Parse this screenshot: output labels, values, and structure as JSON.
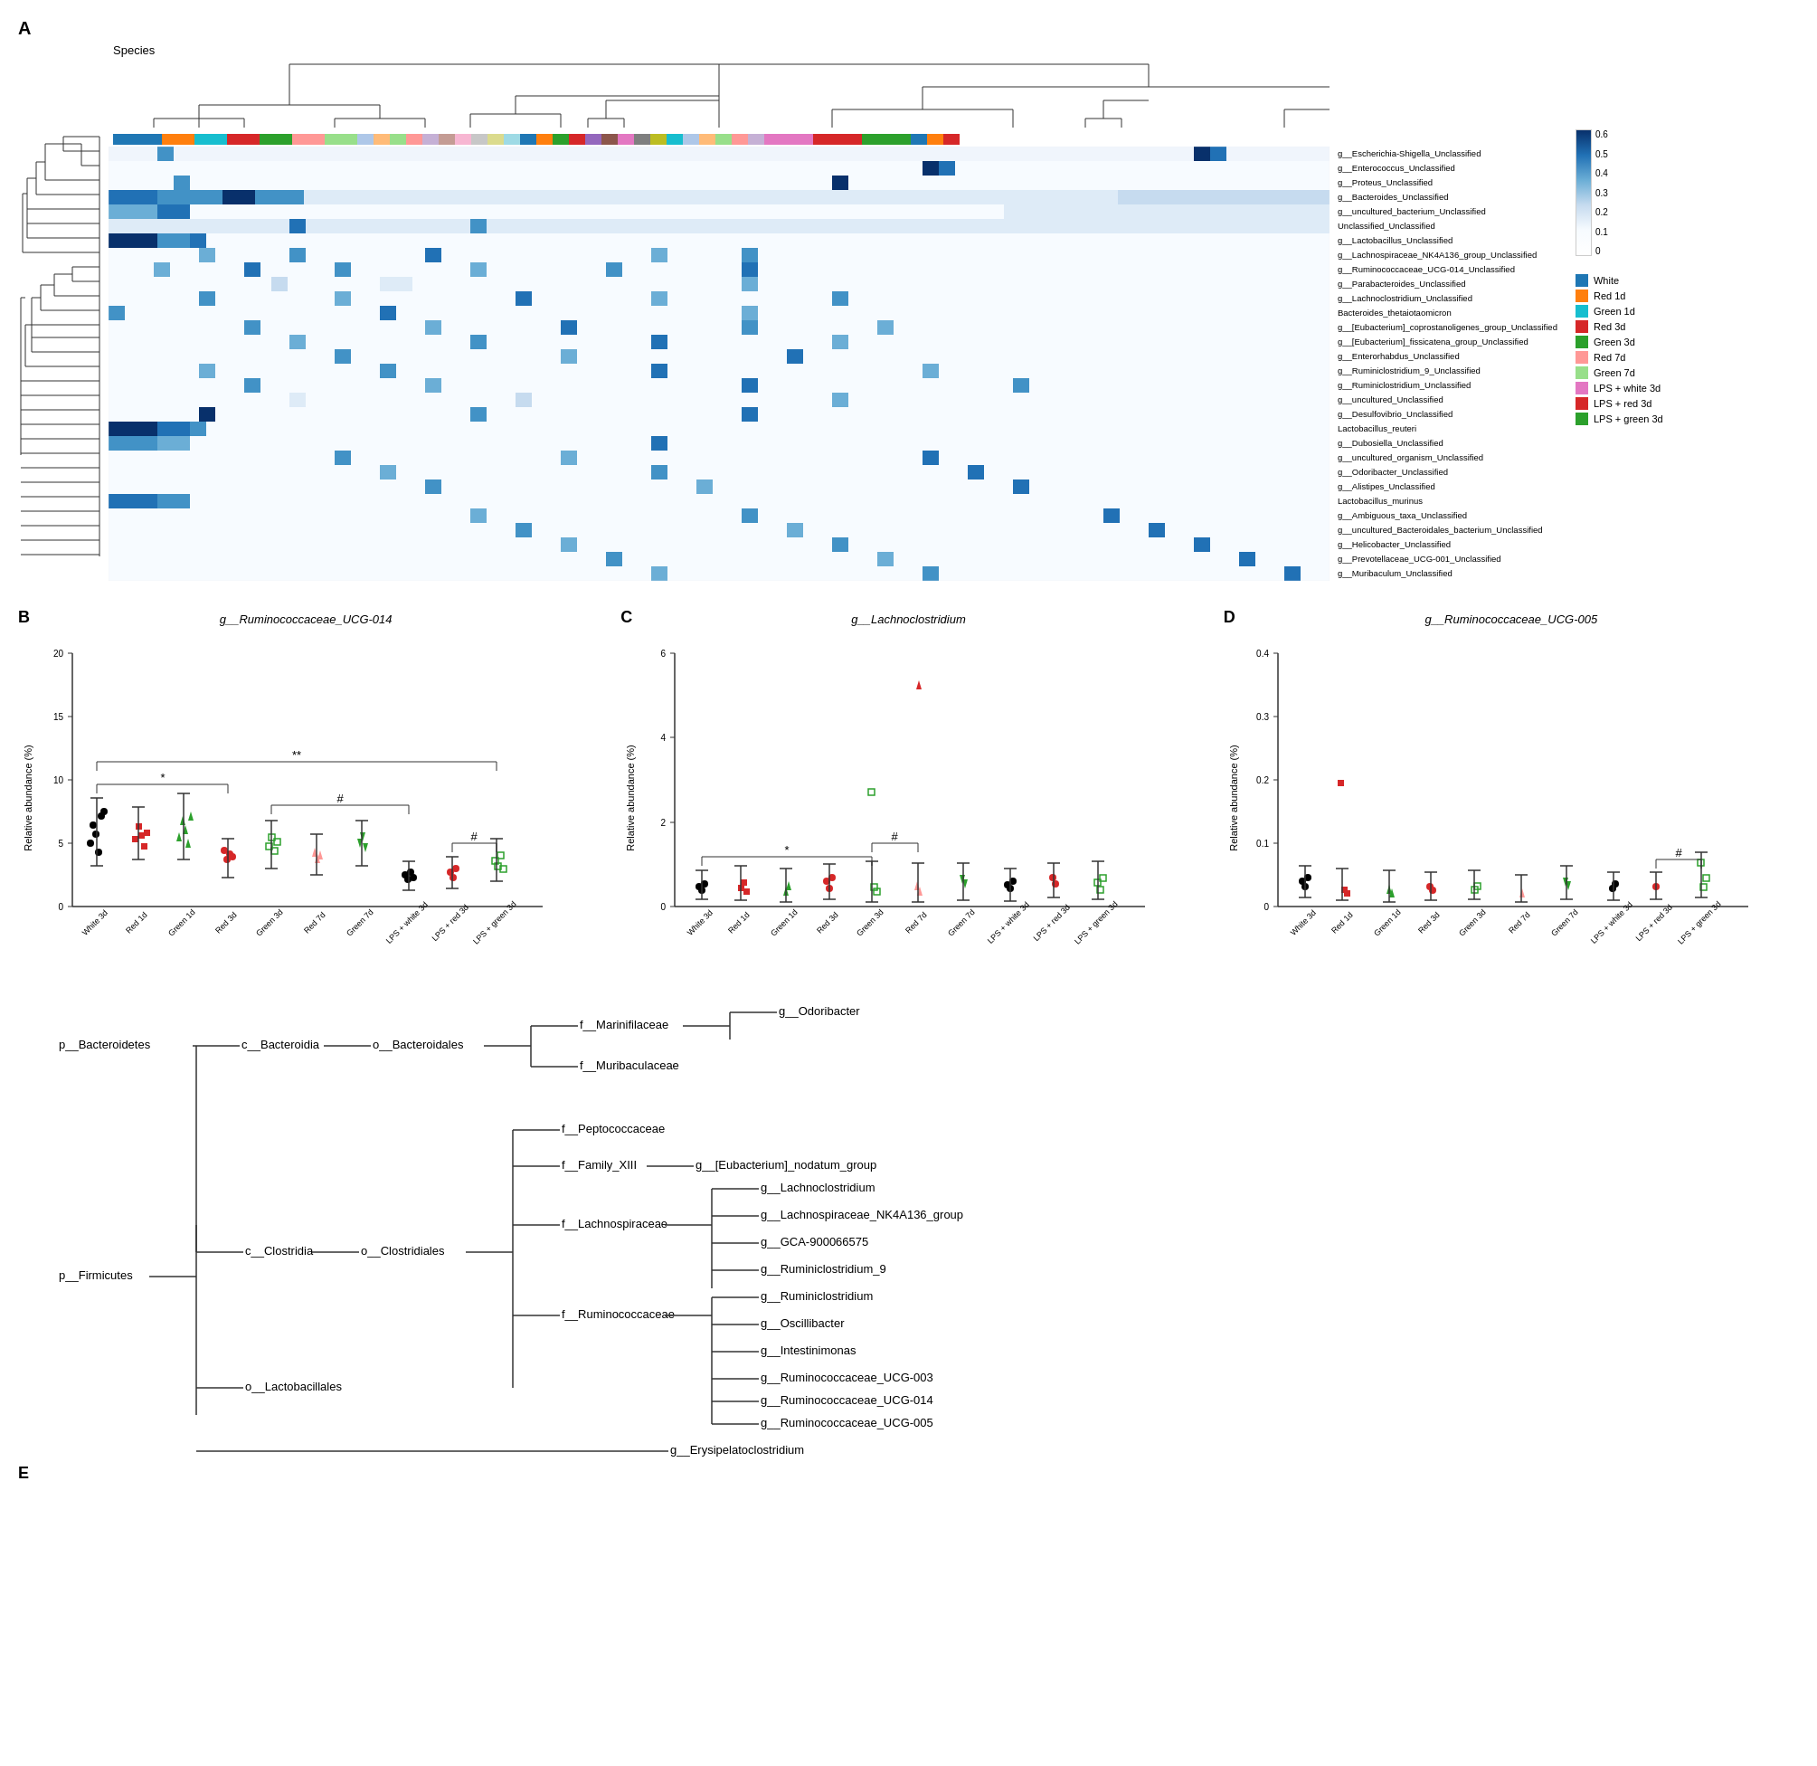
{
  "panelA": {
    "label": "A",
    "title": "Species",
    "species_list": [
      "g__Escherichia-Shigella_Unclassified",
      "g__Enterococcus_Unclassified",
      "g__Proteus_Unclassified",
      "g__Bacteroides_Unclassified",
      "g__uncultured_bacterium_Unclassified",
      "Unclassified_Unclassified",
      "g__Lactobacillus_Unclassified",
      "g__Lachnospiraceae_NK4A136_group_Unclassified",
      "g__Ruminococcaceae_UCG-014_Unclassified",
      "g__Parabacteroides_Unclassified",
      "g__Lachnoclostridium_Unclassified",
      "Bacteroides_thetaiotaomicron",
      "g__[Eubacterium]_coprostanoligenes_group_Unclassified",
      "g__[Eubacterium]_fissicatena_group_Unclassified",
      "g__Enterorhabdus_Unclassified",
      "g__Ruminiclostridium_9_Unclassified",
      "g__Ruminiclostridium_Unclassified",
      "g__uncultured_Unclassified",
      "g__Desulfovibrio_Unclassified",
      "Lactobacillus_reuteri",
      "g__Dubosiella_Unclassified",
      "g__uncultured_organism_Unclassified",
      "g__Odoribacter_Unclassified",
      "g__Alistipes_Unclassified",
      "Lactobacillus_murinus",
      "g__Ambiguous_taxa_Unclassified",
      "g__uncultured_Bacteroidales_bacterium_Unclassified",
      "g__Helicobacter_Unclassified",
      "g__Prevotellaceae_UCG-001_Unclassified",
      "g__Muribaculum_Unclassified"
    ],
    "legend": {
      "colors": [
        {
          "label": "White",
          "color": "#1f77b4"
        },
        {
          "label": "Red 1d",
          "color": "#ff7f0e"
        },
        {
          "label": "Green 1d",
          "color": "#00bcd4"
        },
        {
          "label": "Red 3d",
          "color": "#d62728"
        },
        {
          "label": "Green 3d",
          "color": "#2ca02c"
        },
        {
          "label": "Red 7d",
          "color": "#ff9896"
        },
        {
          "label": "Green 7d",
          "color": "#98df8a"
        },
        {
          "label": "LPS + white 3d",
          "color": "#e377c2"
        },
        {
          "label": "LPS + red 3d",
          "color": "#d62728"
        },
        {
          "label": "LPS + green 3d",
          "color": "#2ca02c"
        }
      ]
    },
    "colorscale": {
      "max": 0.6,
      "ticks": [
        "0.6",
        "0.5",
        "0.4",
        "0.3",
        "0.2",
        "0.1",
        "0"
      ]
    }
  },
  "panelB": {
    "label": "B",
    "title": "g__Ruminococcaceae_UCG-014",
    "y_label": "Relative abundance (%)",
    "x_groups": [
      "White 3d",
      "Red 1d",
      "Green 1d",
      "Red 3d",
      "Green 3d",
      "Red 7d",
      "Green 7d",
      "LPS + white 3d",
      "LPS + red 3d",
      "LPS + green 3d"
    ],
    "y_max": 20,
    "y_ticks": [
      "20",
      "15",
      "10",
      "5",
      "0"
    ],
    "significance": [
      "*",
      "**",
      "#",
      "#"
    ]
  },
  "panelC": {
    "label": "C",
    "title": "g__Lachnoclostridium",
    "y_label": "Relative abundance (%)",
    "x_groups": [
      "White 3d",
      "Red 1d",
      "Green 1d",
      "Red 3d",
      "Green 3d",
      "Red 7d",
      "Green 7d",
      "LPS + white 3d",
      "LPS + red 3d",
      "LPS + green 3d"
    ],
    "y_max": 6,
    "y_ticks": [
      "6",
      "4",
      "2",
      "0"
    ],
    "significance": [
      "*",
      "#"
    ]
  },
  "panelD": {
    "label": "D",
    "title": "g__Ruminococcaceae_UCG-005",
    "y_label": "Relative abundance (%)",
    "x_groups": [
      "White 3d",
      "Red 1d",
      "Green 1d",
      "Red 3d",
      "Green 3d",
      "Red 7d",
      "Green 7d",
      "LPS + white 3d",
      "LPS + red 3d",
      "LPS + green 3d"
    ],
    "y_max": 0.4,
    "y_ticks": [
      "0.4",
      "0.3",
      "0.2",
      "0.1",
      "0"
    ],
    "significance": [
      "#"
    ]
  },
  "panelE": {
    "label": "E",
    "nodes": {
      "p_Bacteroidetes": "p__Bacteroidetes",
      "c_Bacteroidia": "c__Bacteroidia",
      "o_Bacteroidales": "o__Bacteroidales",
      "f_Marinifilaceae": "f__Marinifilaceae",
      "g_Odoribacter": "g__Odoribacter",
      "f_Muribaculaceae": "f__Muribaculaceae",
      "p_Firmicutes": "p__Firmicutes",
      "c_Clostridia": "c__Clostridia",
      "o_Clostridiales": "o__Clostridiales",
      "f_Peptococcaceae": "f__Peptococcaceae",
      "f_Family_XIII": "f__Family_XIII",
      "g_Eubacterium_nodatum": "g__[Eubacterium]_nodatum_group",
      "f_Lachnospiraceae": "f__Lachnospiraceae",
      "g_Lachnoclostridium": "g__Lachnoclostridium",
      "g_Lachnospiraceae_NK4A136": "g__Lachnospiraceae_NK4A136_group",
      "g_GCA": "g__GCA-900066575",
      "f_Ruminococcaceae": "f__Ruminococcaceae",
      "g_Ruminiclostridium_9": "g__Ruminiclostridium_9",
      "g_Ruminiclostridium": "g__Ruminiclostridium",
      "g_Oscillibacter": "g__Oscillibacter",
      "g_Intestinimonas": "g__Intestinimonas",
      "g_Ruminococcaceae_UCG003": "g__Ruminococcaceae_UCG-003",
      "g_Ruminococcaceae_UCG014": "g__Ruminococcaceae_UCG-014",
      "g_Ruminococcaceae_UCG005": "g__Ruminococcaceae_UCG-005",
      "o_Lactobacillales": "o__Lactobacillales",
      "g_Erysipelatoclostridium": "g__Erysipelatoclostridium"
    }
  }
}
